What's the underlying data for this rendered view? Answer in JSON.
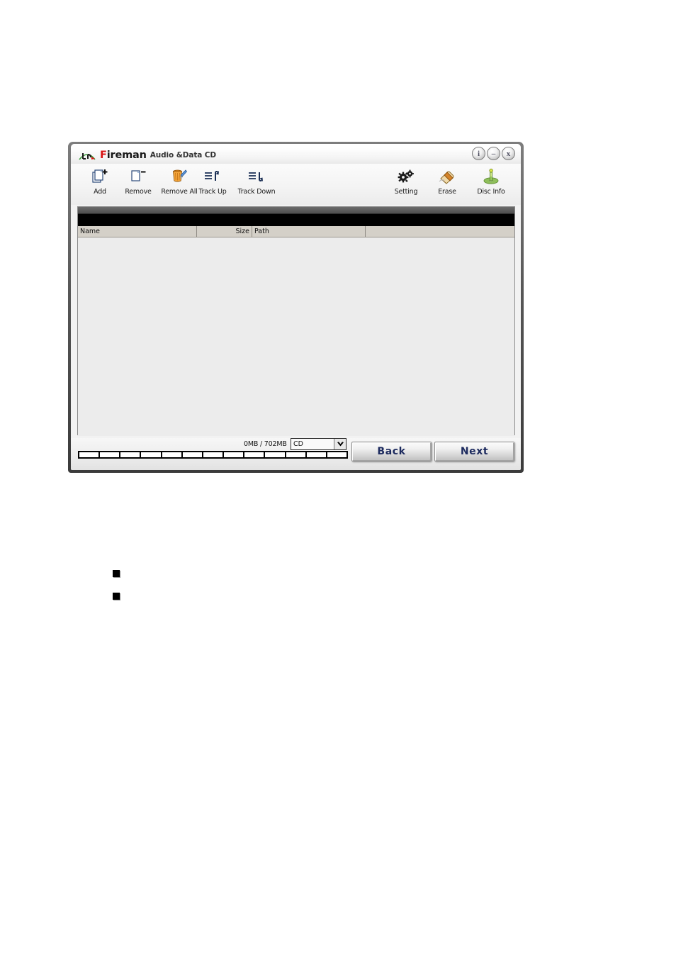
{
  "window": {
    "title_brand": "Fireman",
    "title_brand_first": "F",
    "title_brand_rest": "ireman",
    "title_suffix": "Audio &Data CD",
    "controls": [
      {
        "name": "info-button",
        "glyph": "i"
      },
      {
        "name": "minimize-button",
        "glyph": "–"
      },
      {
        "name": "close-button",
        "glyph": "x"
      }
    ]
  },
  "toolbar": {
    "left": [
      {
        "label": "Add",
        "icon": "add-file-icon"
      },
      {
        "label": "Remove",
        "icon": "remove-file-icon"
      },
      {
        "label": "Remove All",
        "icon": "trash-can-icon"
      }
    ],
    "middle": [
      {
        "label": "Track Up",
        "icon": "track-up-icon"
      },
      {
        "label": "Track Down",
        "icon": "track-down-icon"
      }
    ],
    "right": [
      {
        "label": "Setting",
        "icon": "gears-icon"
      },
      {
        "label": "Erase",
        "icon": "eraser-icon"
      },
      {
        "label": "Disc Info",
        "icon": "disc-info-icon"
      }
    ]
  },
  "list": {
    "columns": [
      {
        "key": "name",
        "label": "Name"
      },
      {
        "key": "size",
        "label": "Size"
      },
      {
        "key": "path",
        "label": "Path"
      },
      {
        "key": "spare",
        "label": ""
      }
    ],
    "rows": []
  },
  "status": {
    "capacity_text": "0MB / 702MB",
    "used_mb": 0,
    "total_mb": 702,
    "segments": 13,
    "media_type": "CD",
    "media_options": [
      "CD"
    ],
    "dropdown_icon": "chevron-down-icon"
  },
  "actions": {
    "back_label": "Back",
    "next_label": "Next"
  },
  "document": {
    "bullets": [
      "",
      ""
    ]
  },
  "colors": {
    "brand_red": "#d81414",
    "brand_green": "#3a9e3a",
    "button_text": "#1c2a5e",
    "header_bg": "#d4d0c8",
    "list_bg": "#ececec",
    "frame": "#575757"
  }
}
